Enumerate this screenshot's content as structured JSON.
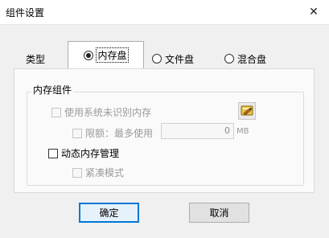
{
  "window": {
    "title": "组件设置",
    "close_glyph": "✕"
  },
  "tabs": [
    {
      "label": "类型"
    },
    {
      "label": "内存盘",
      "selected": true
    },
    {
      "label": "文件盘",
      "selected": false
    },
    {
      "label": "混合盘",
      "selected": false
    }
  ],
  "memory_group": {
    "title": "内存组件",
    "use_unrecognized_memory": {
      "label": "使用系统未识别内存",
      "checked": false,
      "enabled": false
    },
    "limit": {
      "label": "限额：最多使用",
      "checked": false,
      "enabled": false,
      "value": "0",
      "unit": "MB"
    },
    "dynamic_memory": {
      "label": "动态内存管理",
      "checked": false,
      "enabled": true
    },
    "compact_mode": {
      "label": "紧凑模式",
      "checked": false,
      "enabled": false
    },
    "settings_icon": "settings-pad-icon"
  },
  "buttons": {
    "ok": "确定",
    "cancel": "取消"
  },
  "colors": {
    "accent": "#0078d7",
    "window_bg": "#f0f0f0",
    "panel_bg": "#fafafa"
  }
}
